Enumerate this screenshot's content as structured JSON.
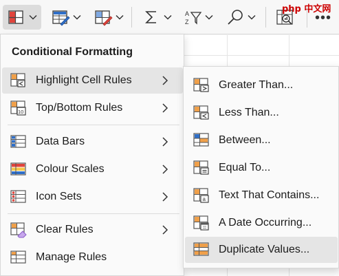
{
  "ribbon": {
    "watermark": "php 中文网",
    "more": "•••",
    "buttons": [
      {
        "icon": "conditional-formatting-icon",
        "active": true
      },
      {
        "icon": "format-as-table-icon"
      },
      {
        "icon": "cell-styles-icon"
      },
      {
        "icon": "autosum-sigma-icon"
      },
      {
        "icon": "sort-filter-icon"
      },
      {
        "icon": "find-select-icon"
      },
      {
        "icon": "analyze-data-icon"
      }
    ]
  },
  "menu": {
    "title": "Conditional Formatting",
    "items": [
      {
        "label": "Highlight Cell Rules",
        "icon": "highlight-cells-icon",
        "has_submenu": true,
        "hovered": true
      },
      {
        "label": "Top/Bottom Rules",
        "icon": "top-bottom-icon",
        "has_submenu": true
      },
      {
        "label": "Data Bars",
        "icon": "data-bars-icon",
        "has_submenu": true
      },
      {
        "label": "Colour Scales",
        "icon": "colour-scales-icon",
        "has_submenu": true
      },
      {
        "label": "Icon Sets",
        "icon": "icon-sets-icon",
        "has_submenu": true
      },
      {
        "label": "Clear Rules",
        "icon": "clear-rules-icon",
        "has_submenu": true
      },
      {
        "label": "Manage Rules",
        "icon": "manage-rules-icon",
        "has_submenu": false
      }
    ]
  },
  "submenu": {
    "items": [
      {
        "label": "Greater Than...",
        "icon": "greater-than-icon"
      },
      {
        "label": "Less Than...",
        "icon": "less-than-icon"
      },
      {
        "label": "Between...",
        "icon": "between-icon"
      },
      {
        "label": "Equal To...",
        "icon": "equal-to-icon"
      },
      {
        "label": "Text That Contains...",
        "icon": "text-contains-icon"
      },
      {
        "label": "A Date Occurring...",
        "icon": "date-occurring-icon"
      },
      {
        "label": "Duplicate Values...",
        "icon": "duplicate-values-icon",
        "hovered": true
      }
    ]
  },
  "colors": {
    "accent_orange": "#f0a04a",
    "accent_blue": "#2f6fc9",
    "accent_red": "#e0443c",
    "accent_purple": "#8a5cc8"
  }
}
